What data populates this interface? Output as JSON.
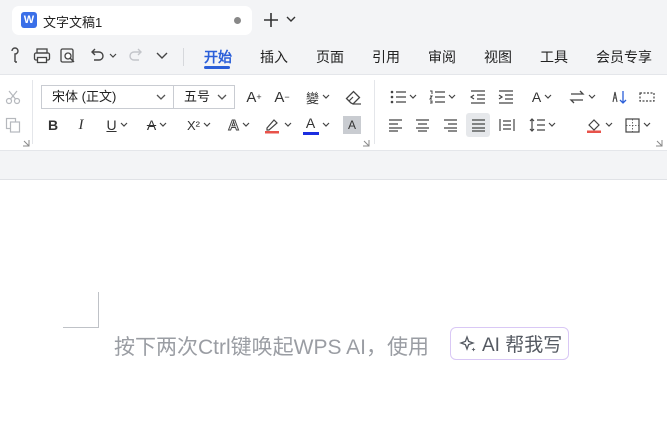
{
  "tab": {
    "logo": "W",
    "title": "文字文稿1"
  },
  "menu": {
    "items": [
      {
        "key": "home",
        "label": "开始",
        "active": true
      },
      {
        "key": "insert",
        "label": "插入"
      },
      {
        "key": "page",
        "label": "页面"
      },
      {
        "key": "references",
        "label": "引用"
      },
      {
        "key": "review",
        "label": "审阅"
      },
      {
        "key": "view",
        "label": "视图"
      },
      {
        "key": "tools",
        "label": "工具"
      },
      {
        "key": "member",
        "label": "会员专享"
      }
    ]
  },
  "ribbon": {
    "font_family": "宋体 (正文)",
    "font_size": "五号",
    "bold": "B",
    "italic": "I",
    "underline": "U",
    "strikethrough": "A",
    "superscript": "X²",
    "text_effect": "A",
    "font_color": "A",
    "char_shading": "A",
    "grow_font": "A",
    "shrink_font": "A",
    "phonetic": "變",
    "case_change": "A",
    "font_color_hex": "#1b2ee0",
    "highlight_hex": "#e8524a"
  },
  "document": {
    "hint": "按下两次Ctrl键唤起WPS AI，使用",
    "ai_button": "AI 帮我写"
  },
  "colors": {
    "accent": "#2b5fd9",
    "ai_border": "#d9c8f5"
  }
}
